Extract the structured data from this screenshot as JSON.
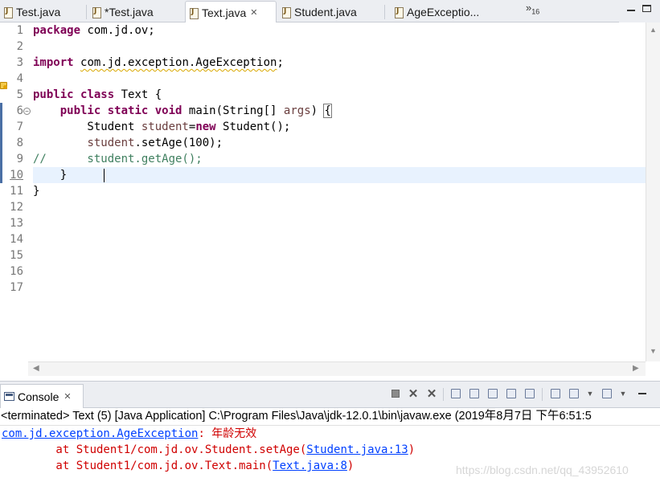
{
  "editor_tabs": [
    {
      "label": "Test.java",
      "active": false,
      "dirty": false
    },
    {
      "label": "*Test.java",
      "active": false,
      "dirty": true
    },
    {
      "label": "Text.java",
      "active": true,
      "dirty": false
    },
    {
      "label": "Student.java",
      "active": false,
      "dirty": false
    },
    {
      "label": "AgeExceptio...",
      "active": false,
      "dirty": false
    }
  ],
  "tab_overflow": {
    "chevron": "»",
    "count": "16"
  },
  "tab_close_glyph": "✕",
  "code": {
    "line_numbers": [
      "1",
      "2",
      "3",
      "4",
      "5",
      "6",
      "7",
      "8",
      "9",
      "10",
      "11",
      "12",
      "13",
      "14",
      "15",
      "16",
      "17"
    ],
    "l1": {
      "kw": "package",
      "rest": " com.jd.ov;"
    },
    "l3": {
      "kw": "import",
      "sp": " ",
      "rest": "com.jd.exception.AgeException",
      "semi": ";"
    },
    "l5": {
      "kw1": "public",
      "kw2": "class",
      "rest": " Text {"
    },
    "l6": {
      "kw1": "public",
      "kw2": "static",
      "kw3": "void",
      "name": " main(String[] ",
      "arg": "args",
      "paren": ") ",
      "brace": "{"
    },
    "l7": {
      "type": "        Student ",
      "var": "student",
      "eq": "=",
      "kw": "new",
      "rest": " Student();"
    },
    "l8": {
      "indent": "        ",
      "var": "student",
      "rest": ".setAge(100);"
    },
    "l9": {
      "text": "//      student.getAge();"
    },
    "l10": {
      "text": "    }"
    },
    "l11": {
      "text": "}"
    }
  },
  "console": {
    "tab_label": "Console",
    "status": "<terminated> Text (5) [Java Application] C:\\Program Files\\Java\\jdk-12.0.1\\bin\\javaw.exe (2019年8月7日 下午6:51:5",
    "exception_class": "com.jd.exception.AgeException",
    "exception_message": ": 年龄无效",
    "trace": [
      {
        "prefix": "        at Student1/com.jd.ov.Student.setAge(",
        "link": "Student.java:13",
        "suffix": ")"
      },
      {
        "prefix": "        at Student1/com.jd.ov.Text.main(",
        "link": "Text.java:8",
        "suffix": ")"
      }
    ]
  },
  "watermark": "https://blog.csdn.net/qq_43952610",
  "colors": {
    "keyword": "#7f0055",
    "variable": "#6a3e3e",
    "comment": "#3f7f5f",
    "error_text": "#d00000",
    "link": "#0040ff",
    "current_line": "#e8f2fe"
  }
}
